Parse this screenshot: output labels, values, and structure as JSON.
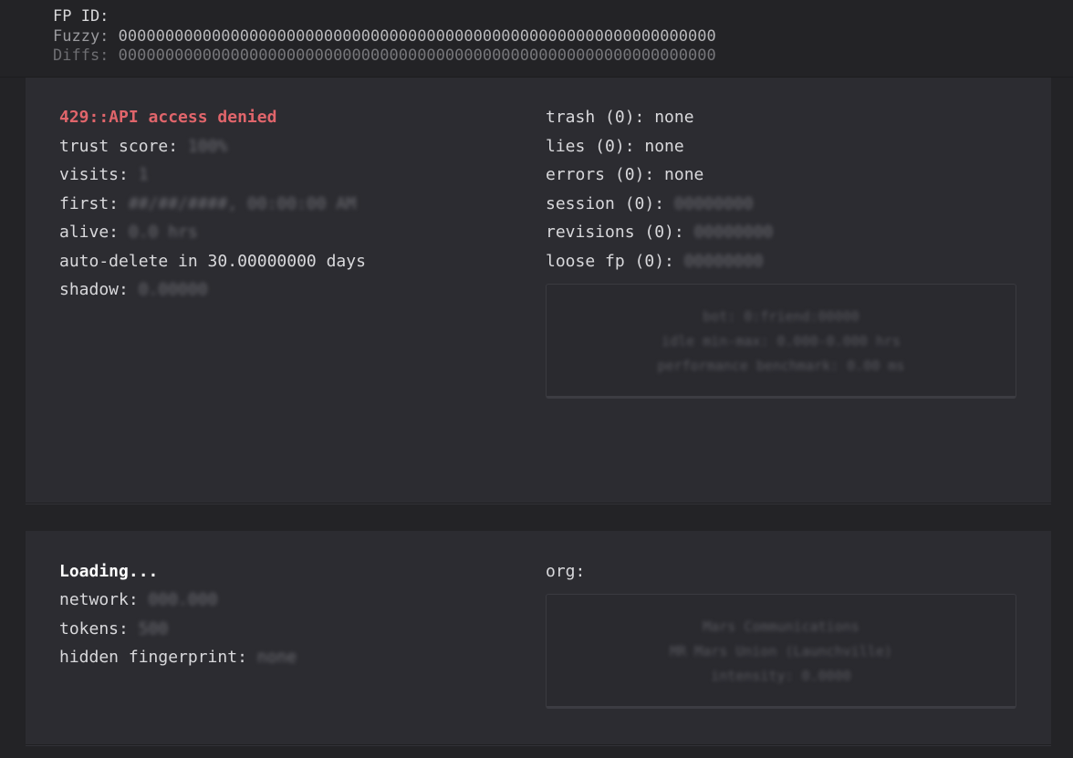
{
  "header": {
    "fp_id_label": "FP ID:",
    "fuzzy_label": "Fuzzy:",
    "fuzzy_value": "0000000000000000000000000000000000000000000000000000000000000000",
    "diffs_label": "Diffs:",
    "diffs_value": "0000000000000000000000000000000000000000000000000000000000000000"
  },
  "panel1": {
    "left": {
      "status": "429::API access denied",
      "trust_label": "trust score: ",
      "trust_value": "100%",
      "visits_label": "visits: ",
      "visits_value": "1",
      "first_label": "first: ",
      "first_value": "##/##/####, 00:00:00 AM",
      "alive_label": "alive: ",
      "alive_value": "0.0 hrs",
      "autodelete_text": "auto-delete in 30.00000000 days",
      "shadow_label": "shadow: ",
      "shadow_value": "0.00000"
    },
    "right": {
      "trash": "trash (0): none",
      "lies": "lies (0): none",
      "errors": "errors (0): none",
      "session_label": "session (0): ",
      "session_value": "00000000",
      "revisions_label": "revisions (0): ",
      "revisions_value": "00000000",
      "loosefp_label": "loose fp (0): ",
      "loosefp_value": "00000000"
    },
    "box": {
      "bot": "bot: 0:friend:00000",
      "idle": "idle min-max: 0.000-0.000 hrs",
      "perf": "performance benchmark: 0.00 ms"
    }
  },
  "panel2": {
    "left": {
      "loading": "Loading...",
      "network_label": "network: ",
      "network_value": "000.000",
      "tokens_label": "tokens: ",
      "tokens_value": "500",
      "hidden_label": "hidden fingerprint: ",
      "hidden_value": "none"
    },
    "right": {
      "org_label": "org:"
    },
    "box": {
      "org_name": "Mars Communications",
      "location": "MR Mars Union (Launchville)",
      "intensity": "intensity: 0.0000"
    }
  },
  "colors": {
    "background": "#232326",
    "panel": "#2c2c31",
    "error": "#e0656b",
    "text": "#d9d9dc"
  }
}
